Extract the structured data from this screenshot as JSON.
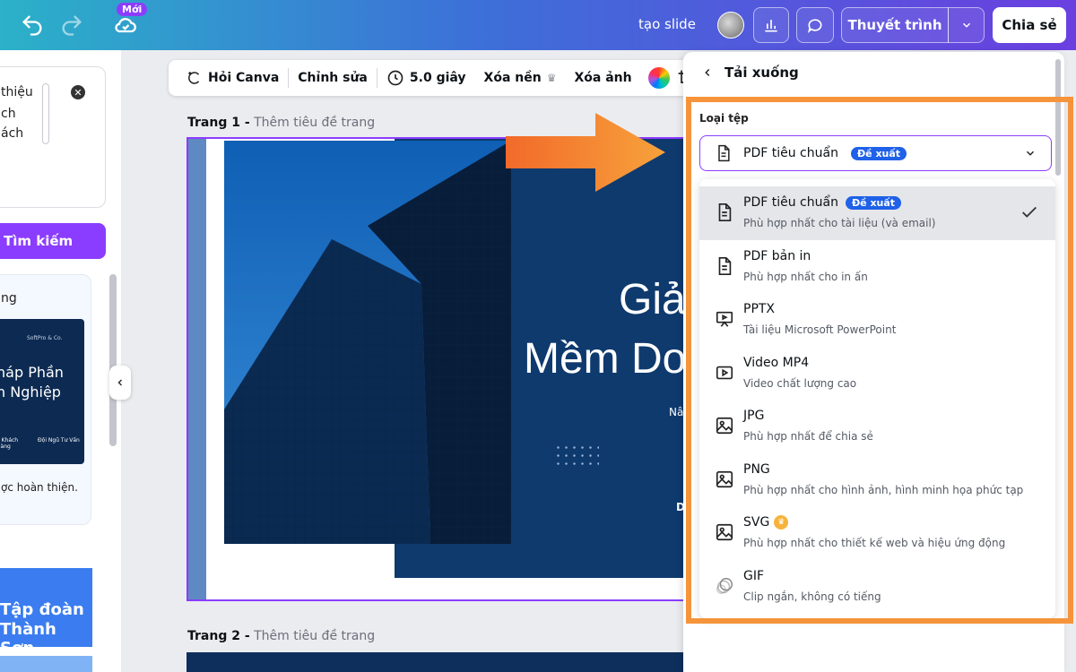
{
  "topbar": {
    "new_badge": "Mới",
    "project_title": "tạo slide",
    "present_label": "Thuyết trình",
    "share_label": "Chia sẻ"
  },
  "left_panel": {
    "snippet_lines": [
      "thiệu",
      "ch",
      "ách"
    ],
    "search_label": "Tìm kiếm",
    "card_text": "ng",
    "thumb_brand": "SoftPro & Co.",
    "thumb_title_1": "háp Phần",
    "thumb_title_2": "h Nghiệp",
    "thumb_left_label": "o Khách\nHàng",
    "thumb_right_label": "Đội Ngũ Tư Vấn",
    "card_caption": "ợc hoàn thiện.",
    "thumb2_title_1": "Tập đoàn",
    "thumb2_title_2": "Thành Sơn"
  },
  "context_toolbar": {
    "ask_canva": "Hỏi Canva",
    "edit": "Chỉnh sửa",
    "duration": "5.0 giây",
    "remove_bg": "Xóa nền",
    "remove_image": "Xóa ảnh"
  },
  "pages": [
    {
      "label": "Trang 1 -",
      "subtitle": "Thêm tiêu đề trang"
    },
    {
      "label": "Trang 2 -",
      "subtitle": "Thêm tiêu đề trang"
    }
  ],
  "slide1": {
    "title_line1": "Giả",
    "title_line2": "Mềm Do",
    "small_text": "Nân",
    "corner_text": "D"
  },
  "download_panel": {
    "header": "Tải xuống",
    "file_type_label": "Loại tệp",
    "selected_value": "PDF tiêu chuẩn",
    "selected_badge": "Đề xuất",
    "options": [
      {
        "title": "PDF tiêu chuẩn",
        "badge": "Đề xuất",
        "desc": "Phù hợp nhất cho tài liệu (và email)",
        "icon": "document-icon",
        "selected": true
      },
      {
        "title": "PDF bản in",
        "desc": "Phù hợp nhất cho in ấn",
        "icon": "document-icon"
      },
      {
        "title": "PPTX",
        "desc": "Tài liệu Microsoft PowerPoint",
        "icon": "presentation-icon"
      },
      {
        "title": "Video MP4",
        "desc": "Video chất lượng cao",
        "icon": "video-icon"
      },
      {
        "title": "JPG",
        "desc": "Phù hợp nhất để chia sẻ",
        "icon": "image-icon"
      },
      {
        "title": "PNG",
        "desc": "Phù hợp nhất cho hình ảnh, hình minh họa phức tạp",
        "icon": "image-icon"
      },
      {
        "title": "SVG",
        "desc": "Phù hợp nhất cho thiết kế web và hiệu ứng động",
        "icon": "image-icon",
        "premium": true
      },
      {
        "title": "GIF",
        "desc": "Clip ngắn, không có tiếng",
        "icon": "gif-icon"
      }
    ]
  },
  "colors": {
    "accent": "#8b3dff",
    "badge_blue": "#1f61e8",
    "highlight_orange": "#f5943a",
    "slide_navy": "#0e3a6e"
  }
}
